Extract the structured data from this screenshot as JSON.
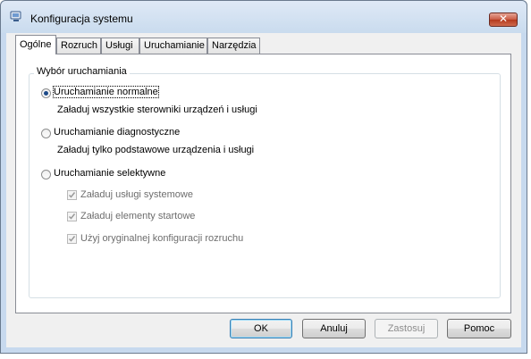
{
  "window": {
    "title": "Konfiguracja systemu",
    "close_label": "✕"
  },
  "tabs": [
    {
      "label": "Ogólne",
      "active": true
    },
    {
      "label": "Rozruch",
      "active": false
    },
    {
      "label": "Usługi",
      "active": false
    },
    {
      "label": "Uruchamianie",
      "active": false
    },
    {
      "label": "Narzędzia",
      "active": false
    }
  ],
  "startup_group": {
    "title": "Wybór uruchamiania",
    "options": [
      {
        "label": "Uruchamianie normalne",
        "description": "Załaduj wszystkie sterowniki urządzeń i usługi",
        "selected": true
      },
      {
        "label": "Uruchamianie diagnostyczne",
        "description": "Załaduj tylko podstawowe urządzenia i usługi",
        "selected": false
      },
      {
        "label": "Uruchamianie selektywne",
        "description": "",
        "selected": false
      }
    ],
    "selective_items": [
      {
        "label": "Załaduj usługi systemowe",
        "checked": true,
        "enabled": false
      },
      {
        "label": "Załaduj elementy startowe",
        "checked": true,
        "enabled": false
      },
      {
        "label": "Użyj oryginalnej konfiguracji rozruchu",
        "checked": true,
        "enabled": false
      }
    ]
  },
  "buttons": {
    "ok": "OK",
    "cancel": "Anuluj",
    "apply": "Zastosuj",
    "help": "Pomoc"
  },
  "colors": {
    "frame": "#c7d9ee",
    "close_button": "#c95a43",
    "radio_dot": "#1d4a88",
    "default_button_border": "#3c7fb1"
  }
}
